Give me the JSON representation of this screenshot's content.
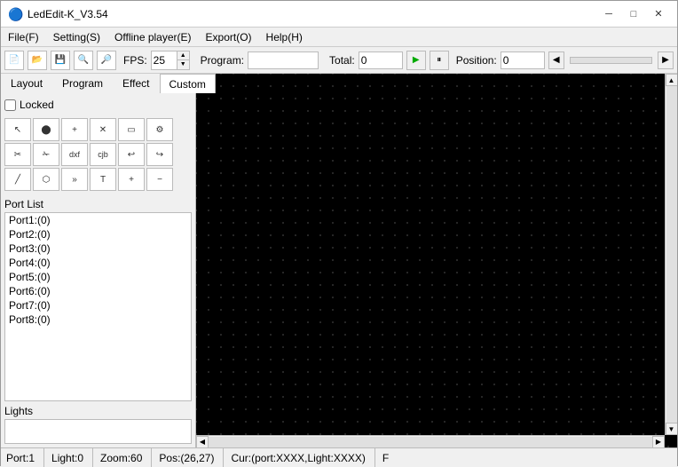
{
  "app": {
    "title": "LedEdit-K_V3.54",
    "icon": "🔵"
  },
  "win_controls": {
    "minimize": "─",
    "maximize": "□",
    "close": "✕"
  },
  "menu": {
    "items": [
      {
        "id": "file",
        "label": "File(F)"
      },
      {
        "id": "setting",
        "label": "Setting(S)"
      },
      {
        "id": "offline",
        "label": "Offline player(E)"
      },
      {
        "id": "export",
        "label": "Export(O)"
      },
      {
        "id": "help",
        "label": "Help(H)"
      }
    ]
  },
  "toolbar": {
    "fps_label": "FPS:",
    "fps_value": "25",
    "program_label": "Program:",
    "program_value": "",
    "total_label": "Total:",
    "total_value": "0",
    "position_label": "Position:",
    "position_value": "0"
  },
  "tabs": {
    "items": [
      {
        "id": "layout",
        "label": "Layout",
        "active": false
      },
      {
        "id": "program",
        "label": "Program",
        "active": false
      },
      {
        "id": "effect",
        "label": "Effect",
        "active": false
      },
      {
        "id": "custom",
        "label": "Custom",
        "active": true
      }
    ]
  },
  "panel": {
    "locked_label": "Locked",
    "locked_checked": false
  },
  "tools": {
    "rows": [
      [
        {
          "id": "select",
          "icon": "↖",
          "label": "select",
          "disabled": false
        },
        {
          "id": "draw-dot",
          "icon": "⬤",
          "label": "draw-dot",
          "disabled": false
        },
        {
          "id": "add",
          "icon": "+",
          "label": "add",
          "disabled": false
        },
        {
          "id": "cross",
          "icon": "╳",
          "label": "cross",
          "disabled": false
        },
        {
          "id": "rect-select",
          "icon": "▭",
          "label": "rect-select",
          "disabled": false
        },
        {
          "id": "gear",
          "icon": "⚙",
          "label": "gear",
          "disabled": false
        }
      ],
      [
        {
          "id": "scissors",
          "icon": "✂",
          "label": "scissors",
          "disabled": false
        },
        {
          "id": "cut",
          "icon": "✁",
          "label": "cut",
          "disabled": false
        },
        {
          "id": "dxf",
          "icon": "dxf",
          "label": "dxf",
          "disabled": false
        },
        {
          "id": "cjb",
          "icon": "cjb",
          "label": "cjb",
          "disabled": false
        },
        {
          "id": "undo",
          "icon": "↩",
          "label": "undo",
          "disabled": false
        },
        {
          "id": "redo",
          "icon": "↪",
          "label": "redo",
          "disabled": false
        }
      ],
      [
        {
          "id": "line",
          "icon": "╱",
          "label": "line",
          "disabled": false
        },
        {
          "id": "arrow",
          "icon": "⬡",
          "label": "arrow",
          "disabled": false
        },
        {
          "id": "double-arrow",
          "icon": "»",
          "label": "double-arrow",
          "disabled": false
        },
        {
          "id": "text",
          "icon": "T",
          "label": "text",
          "disabled": false
        },
        {
          "id": "plus2",
          "icon": "+",
          "label": "plus2",
          "disabled": false
        },
        {
          "id": "minus",
          "icon": "−",
          "label": "minus",
          "disabled": false
        }
      ]
    ]
  },
  "port_list": {
    "label": "Port List",
    "items": [
      "Port1:(0)",
      "Port2:(0)",
      "Port3:(0)",
      "Port4:(0)",
      "Port5:(0)",
      "Port6:(0)",
      "Port7:(0)",
      "Port8:(0)"
    ]
  },
  "lights": {
    "label": "Lights",
    "value": ""
  },
  "status_bar": {
    "port": "Port:1",
    "light": "Light:0",
    "zoom": "Zoom:60",
    "pos": "Pos:(26,27)",
    "cur": "Cur:(port:XXXX,Light:XXXX)",
    "flag": "F"
  }
}
